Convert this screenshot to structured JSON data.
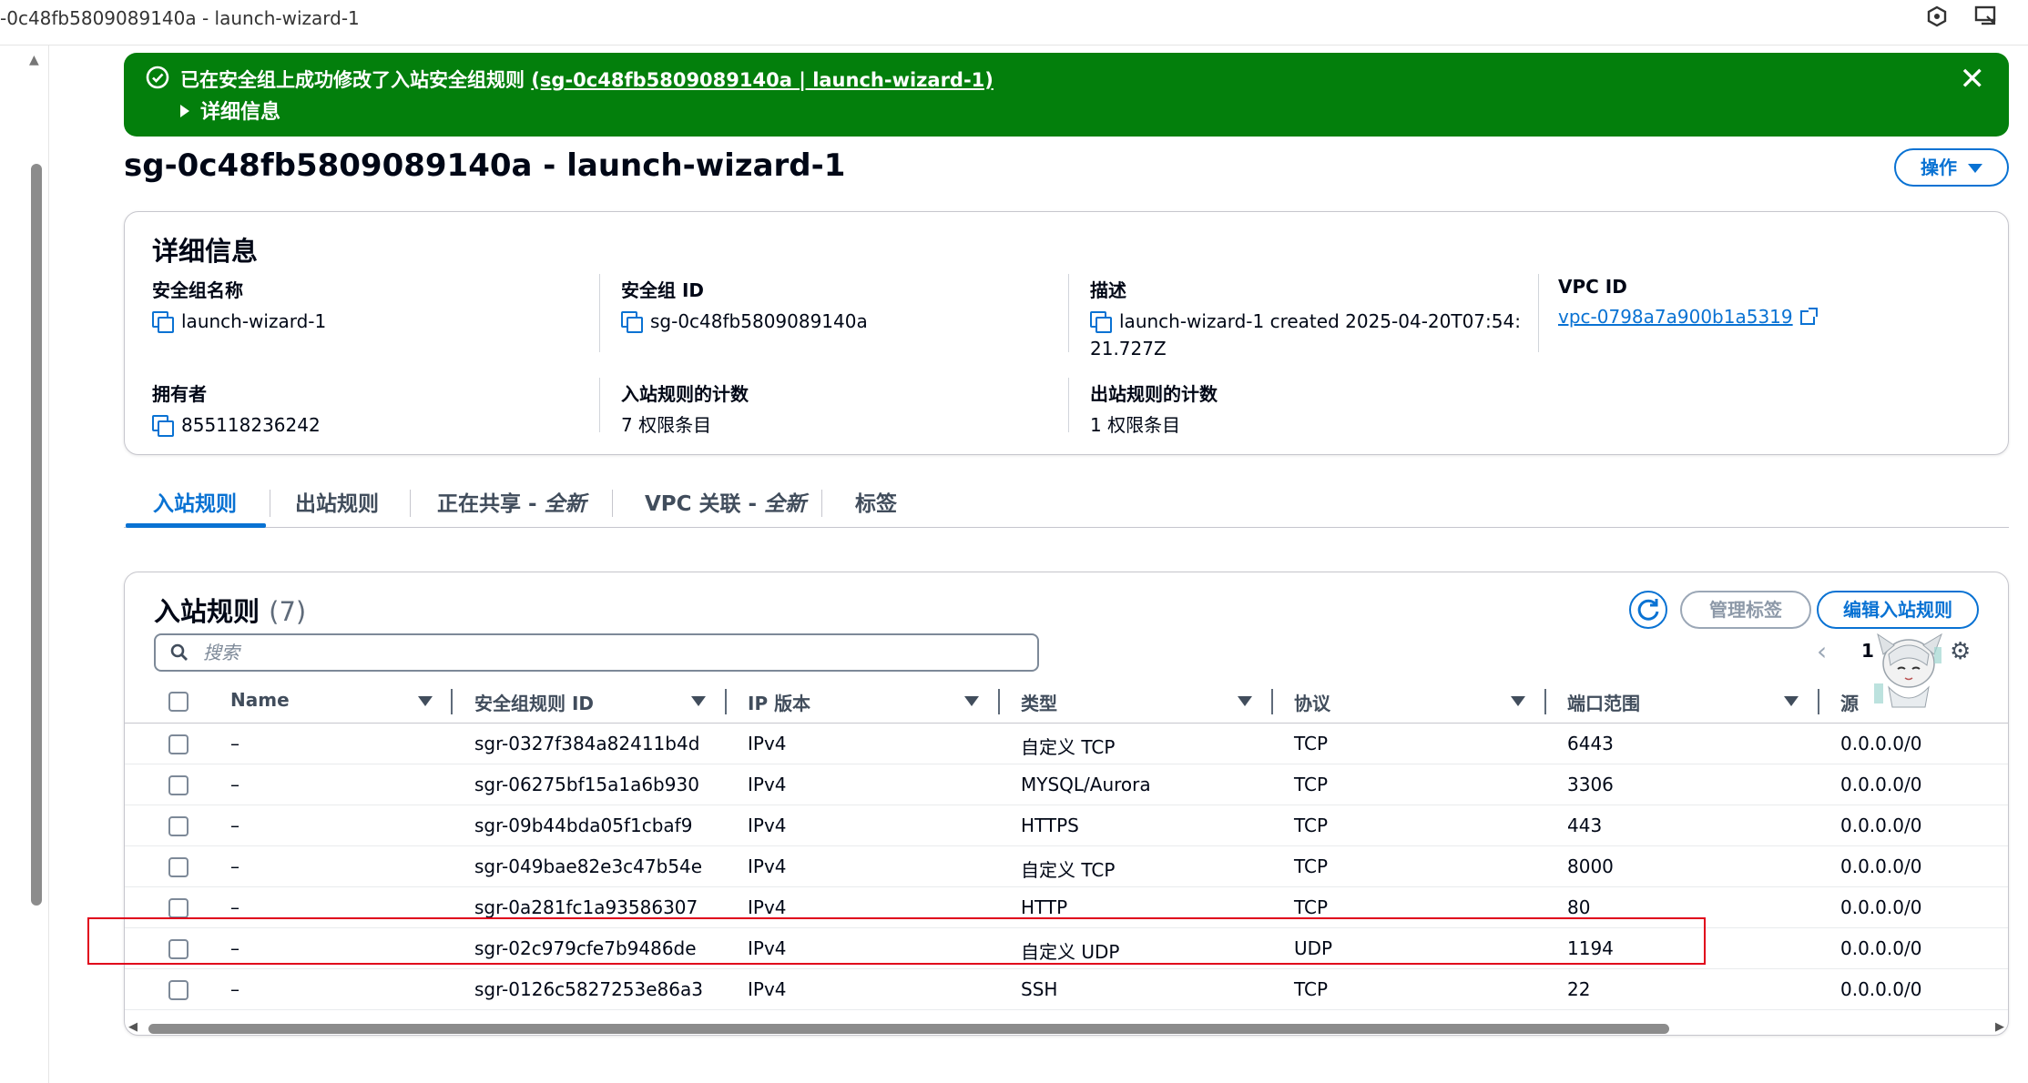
{
  "window": {
    "title": "-0c48fb5809089140a - launch-wizard-1",
    "icons": [
      "hexagon-icon",
      "screen-share-icon"
    ]
  },
  "flash": {
    "message_prefix": "已在安全组上成功修改了入站安全组规则 ",
    "message_link": "(sg-0c48fb5809089140a | launch-wizard-1)",
    "details_label": "详细信息",
    "color": "#037f0c"
  },
  "page": {
    "title": "sg-0c48fb5809089140a - launch-wizard-1",
    "actions_label": "操作"
  },
  "details": {
    "heading": "详细信息",
    "sg_name": {
      "label": "安全组名称",
      "value": "launch-wizard-1"
    },
    "sg_id": {
      "label": "安全组 ID",
      "value": "sg-0c48fb5809089140a"
    },
    "description": {
      "label": "描述",
      "value_line1": "launch-wizard-1 created 2025-04-20T07:54:",
      "value_line2": "21.727Z"
    },
    "vpc_id": {
      "label": "VPC ID",
      "value": "vpc-0798a7a900b1a5319"
    },
    "owner": {
      "label": "拥有者",
      "value": "855118236242"
    },
    "inbound_count": {
      "label": "入站规则的计数",
      "value": "7 权限条目"
    },
    "outbound_count": {
      "label": "出站规则的计数",
      "value": "1 权限条目"
    }
  },
  "tabs": [
    {
      "label": "入站规则",
      "active": true
    },
    {
      "label": "出站规则"
    },
    {
      "label": "正在共享 - ",
      "suffix": "全新"
    },
    {
      "label": "VPC 关联 - ",
      "suffix": "全新"
    },
    {
      "label": "标签"
    }
  ],
  "rules": {
    "heading": "入站规则",
    "count": "(7)",
    "manage_tags_label": "管理标签",
    "edit_label": "编辑入站规则",
    "search_placeholder": "搜索",
    "page_number": "1",
    "columns": [
      "Name",
      "安全组规则 ID",
      "IP 版本",
      "类型",
      "协议",
      "端口范围",
      "源"
    ],
    "rows": [
      {
        "name": "–",
        "id": "sgr-0327f384a82411b4d",
        "ip": "IPv4",
        "type": "自定义 TCP",
        "proto": "TCP",
        "port": "6443",
        "source": "0.0.0.0/0"
      },
      {
        "name": "–",
        "id": "sgr-06275bf15a1a6b930",
        "ip": "IPv4",
        "type": "MYSQL/Aurora",
        "proto": "TCP",
        "port": "3306",
        "source": "0.0.0.0/0"
      },
      {
        "name": "–",
        "id": "sgr-09b44bda05f1cbaf9",
        "ip": "IPv4",
        "type": "HTTPS",
        "proto": "TCP",
        "port": "443",
        "source": "0.0.0.0/0"
      },
      {
        "name": "–",
        "id": "sgr-049bae82e3c47b54e",
        "ip": "IPv4",
        "type": "自定义 TCP",
        "proto": "TCP",
        "port": "8000",
        "source": "0.0.0.0/0"
      },
      {
        "name": "–",
        "id": "sgr-0a281fc1a93586307",
        "ip": "IPv4",
        "type": "HTTP",
        "proto": "TCP",
        "port": "80",
        "source": "0.0.0.0/0"
      },
      {
        "name": "–",
        "id": "sgr-02c979cfe7b9486de",
        "ip": "IPv4",
        "type": "自定义 UDP",
        "proto": "UDP",
        "port": "1194",
        "source": "0.0.0.0/0",
        "highlighted": true
      },
      {
        "name": "–",
        "id": "sgr-0126c5827253e86a3",
        "ip": "IPv4",
        "type": "SSH",
        "proto": "TCP",
        "port": "22",
        "source": "0.0.0.0/0"
      }
    ],
    "highlight_color": "#e0001b"
  },
  "colors": {
    "accent": "#0972d3",
    "text": "#000716",
    "muted": "#414d5c"
  }
}
